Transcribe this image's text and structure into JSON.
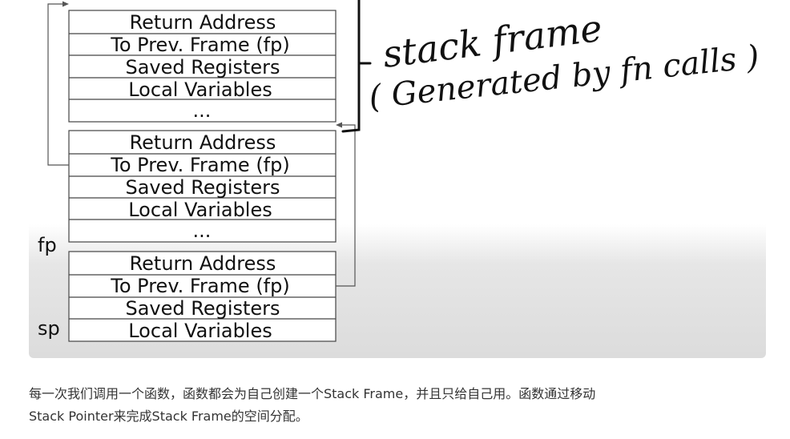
{
  "diagram": {
    "frames": [
      {
        "cells": [
          "Return Address",
          "To Prev. Frame (fp)",
          "Saved Registers",
          "Local Variables",
          "..."
        ]
      },
      {
        "cells": [
          "Return Address",
          "To Prev. Frame (fp)",
          "Saved Registers",
          "Local Variables",
          "..."
        ]
      },
      {
        "cells": [
          "Return Address",
          "To Prev. Frame (fp)",
          "Saved Registers",
          "Local Variables"
        ]
      }
    ],
    "labels": {
      "fp": "fp",
      "sp": "sp"
    },
    "annotation": {
      "line1": "stack frame",
      "line2": "( Generated by fn calls )"
    }
  },
  "caption": {
    "line1": "每一次我们调用一个函数，函数都会为自己创建一个Stack Frame，并且只给自己用。函数通过移动",
    "line2": "Stack Pointer来完成Stack Frame的空间分配。"
  }
}
